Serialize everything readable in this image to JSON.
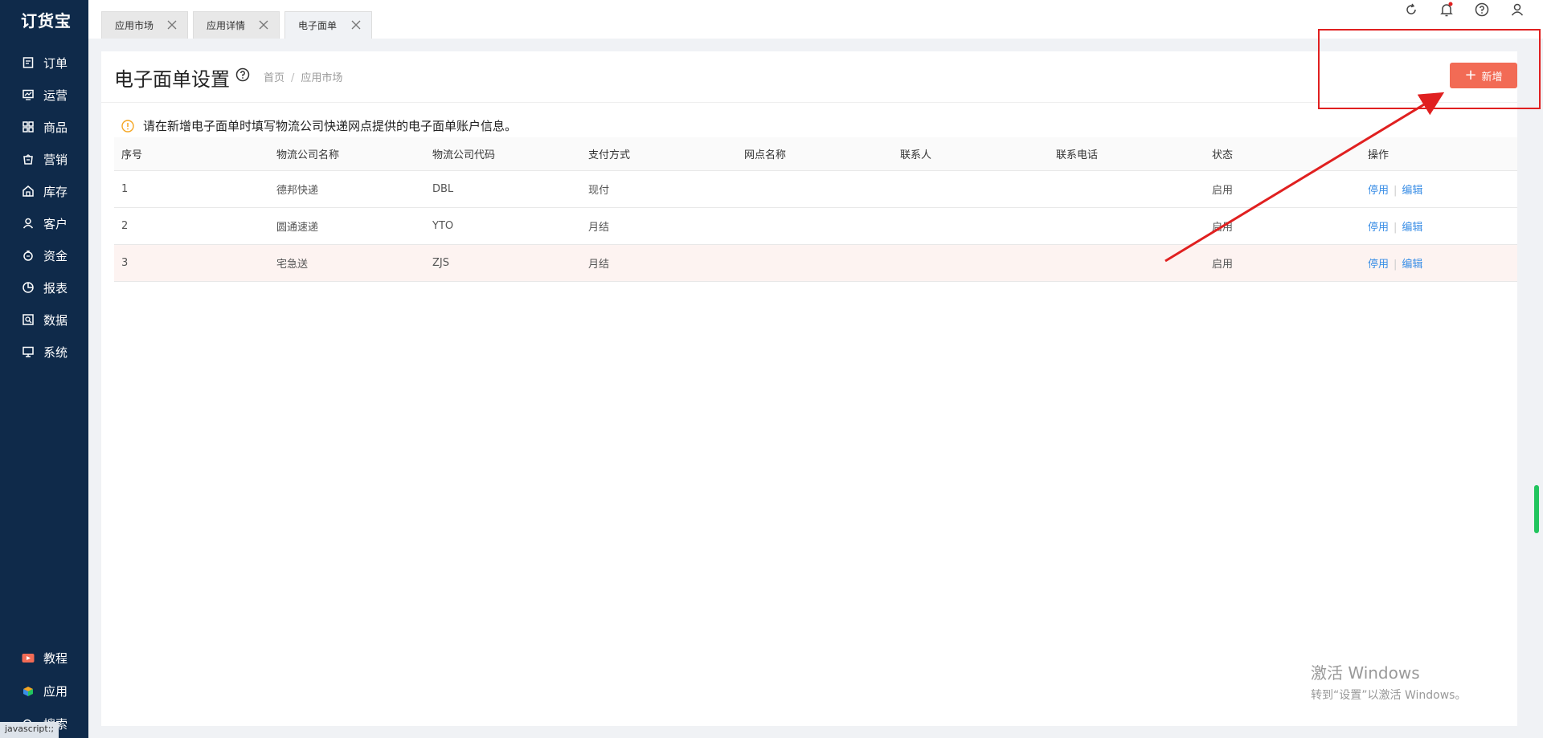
{
  "app": {
    "logo": "订货宝"
  },
  "sidebar": {
    "items": [
      {
        "label": "订单",
        "icon": "order-icon"
      },
      {
        "label": "运营",
        "icon": "operation-icon"
      },
      {
        "label": "商品",
        "icon": "goods-icon"
      },
      {
        "label": "营销",
        "icon": "marketing-icon"
      },
      {
        "label": "库存",
        "icon": "warehouse-icon"
      },
      {
        "label": "客户",
        "icon": "customer-icon"
      },
      {
        "label": "资金",
        "icon": "funds-icon"
      },
      {
        "label": "报表",
        "icon": "report-icon"
      },
      {
        "label": "数据",
        "icon": "data-icon"
      },
      {
        "label": "系统",
        "icon": "system-icon"
      }
    ],
    "bottom": [
      {
        "label": "教程",
        "icon": "tutorial-icon"
      },
      {
        "label": "应用",
        "icon": "apps-icon"
      },
      {
        "label": "搜索",
        "icon": "search-icon"
      }
    ]
  },
  "tabs": [
    {
      "label": "应用市场"
    },
    {
      "label": "应用详情"
    },
    {
      "label": "电子面单"
    }
  ],
  "page": {
    "title": "电子面单设置",
    "breadcrumb": [
      "首页",
      "应用市场"
    ],
    "add_label": "新增",
    "notice": "请在新增电子面单时填写物流公司快递网点提供的电子面单账户信息。"
  },
  "table": {
    "columns": [
      "序号",
      "物流公司名称",
      "物流公司代码",
      "支付方式",
      "网点名称",
      "联系人",
      "联系电话",
      "状态",
      "操作"
    ],
    "rows": [
      {
        "no": "1",
        "name": "德邦快递",
        "code": "DBL",
        "pay": "现付",
        "branch": "",
        "contact": "",
        "phone": "",
        "status": "启用",
        "disable": "停用",
        "edit": "编辑"
      },
      {
        "no": "2",
        "name": "圆通速递",
        "code": "YTO",
        "pay": "月结",
        "branch": "",
        "contact": "",
        "phone": "",
        "status": "启用",
        "disable": "停用",
        "edit": "编辑"
      },
      {
        "no": "3",
        "name": "宅急送",
        "code": "ZJS",
        "pay": "月结",
        "branch": "",
        "contact": "",
        "phone": "",
        "status": "启用",
        "disable": "停用",
        "edit": "编辑"
      }
    ]
  },
  "watermark": {
    "line1": "激活 Windows",
    "line2": "转到“设置”以激活 Windows。"
  },
  "statusbar": "javascript:;",
  "colors": {
    "sidebar": "#0f2a4a",
    "accent": "#f26b55",
    "link": "#3a8ee6",
    "annotation": "#e02020"
  }
}
